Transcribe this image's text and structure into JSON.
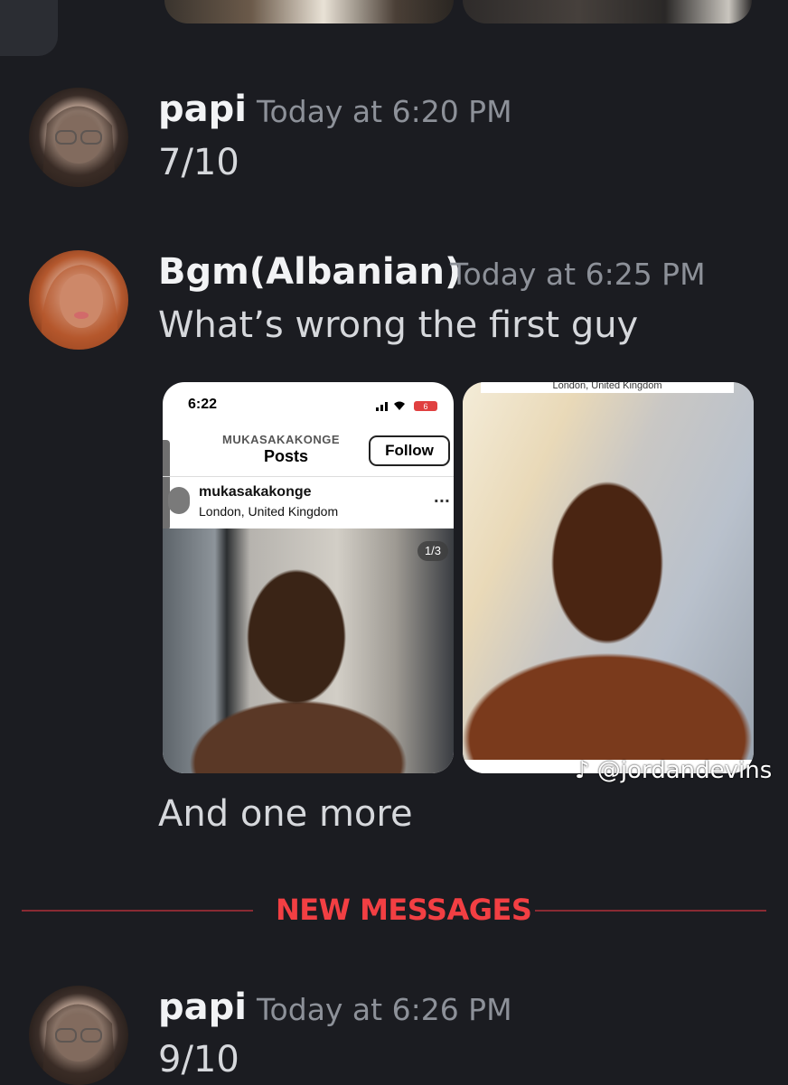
{
  "messages": [
    {
      "author": "papi",
      "timestamp": "Today at 6:20 PM",
      "content": "7/10",
      "avatar": "papi-avatar"
    },
    {
      "author": "Bgm(Albanian)",
      "timestamp": "Today at 6:25 PM",
      "content": "What’s wrong the first guy",
      "followup": "And one more",
      "avatar": "bgm-avatar",
      "attachments": [
        {
          "type": "instagram-screenshot",
          "status_time": "6:22",
          "battery": "6",
          "profile_upper": "MUKASAKAKONGE",
          "page_title": "Posts",
          "follow_label": "Follow",
          "handle": "mukasakakonge",
          "location": "London, United Kingdom",
          "more_label": "...",
          "counter": "1/3"
        },
        {
          "type": "photo",
          "top_caption": "London, United Kingdom"
        }
      ]
    },
    {
      "author": "papi",
      "timestamp": "Today at 6:26 PM",
      "content": "9/10",
      "avatar": "papi-avatar"
    }
  ],
  "divider": {
    "label": "NEW MESSAGES"
  },
  "watermark": {
    "icon": "tiktok-icon",
    "text": "@jordandevins"
  },
  "colors": {
    "background": "#1b1c21",
    "new_messages": "#f23f43",
    "timestamp": "#8d9199"
  }
}
